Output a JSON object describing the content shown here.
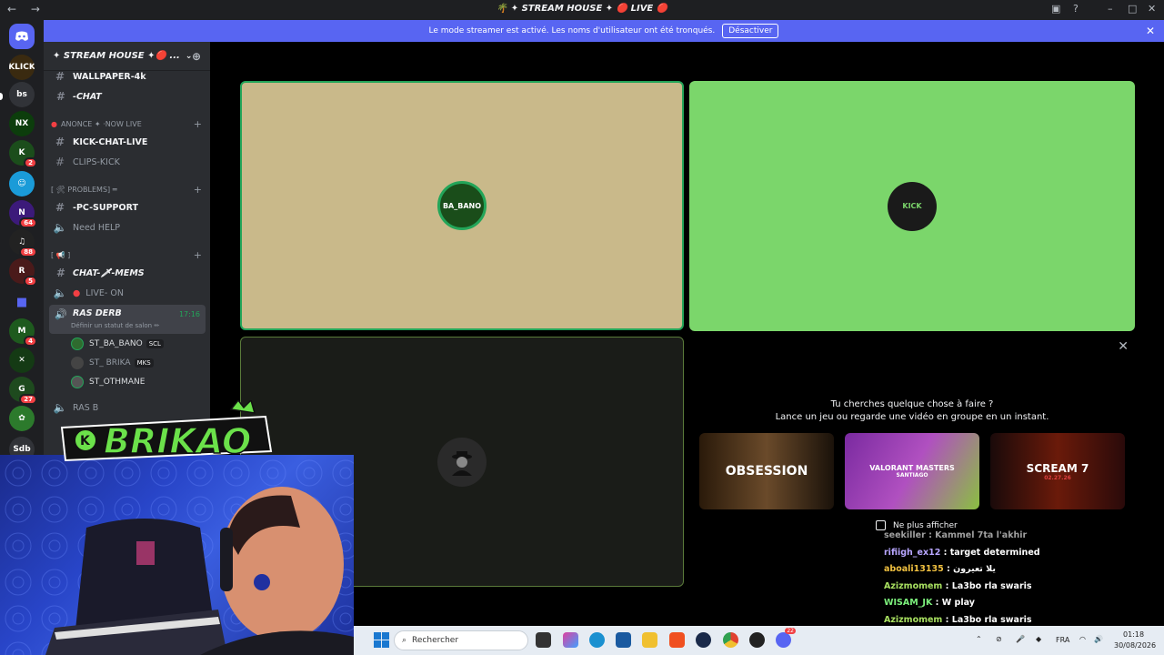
{
  "window": {
    "title": "🌴 ✦ STREAM HOUSE ✦ 🔴 LIVE 🔴",
    "nav_back": "←",
    "nav_forward": "→"
  },
  "streamer_bar": {
    "text": "Le mode streamer est activé. Les noms d'utilisateur ont été tronqués.",
    "button": "Désactiver"
  },
  "guild_labels": {
    "bs": "bs",
    "sdb": "Sdb"
  },
  "guild_badges": [
    "2",
    "64",
    "88",
    "5",
    "4",
    "27"
  ],
  "server": {
    "name": "✦ STREAM HOUSE ✦🔴 ..."
  },
  "channels": {
    "wallpaper": "WALLPAPER-4k",
    "chat": "-CHAT",
    "cat_annonce": "ANONCE ✦ ·NOW LIVE",
    "kick_chat": "KICK-CHAT-LIVE",
    "clips_kick": "CLIPS-KICK",
    "cat_problems": "[ 🛠 PROBLEMS] ═",
    "pc_support": "-PC-SUPPORT",
    "need_help": "Need HELP",
    "cat_misc": "[ 📢 ]",
    "chat_mems": "CHAT-🗡-MEMS",
    "live_on": "LIVE- ON",
    "ras_derb": "RAS DERB",
    "ras_derb_time": "17:16",
    "ras_derb_status": "Définir un statut de salon ✏",
    "rasb": "RAS B"
  },
  "voice_users": [
    {
      "name": "ST_BA_BANO",
      "tag": "SCL"
    },
    {
      "name": "ST_ BRIKA",
      "tag": "MKS"
    },
    {
      "name": "ST_OTHMANE",
      "tag": ""
    }
  ],
  "tiles": {
    "babano_avatar": "BA_BANO",
    "brika_avatar": "KICK"
  },
  "overlay": {
    "brand": "BRIKAO",
    "k": "K"
  },
  "activity": {
    "line1": "Tu cherches quelque chose à faire ?",
    "line2": "Lance un jeu ou regarde une vidéo en groupe en un instant.",
    "cards": [
      {
        "label": "OBSESSION"
      },
      {
        "label": "VALORANT MASTERS",
        "sub": "SANTIAGO"
      },
      {
        "label": "SCREAM 7",
        "sub": "02.27.26"
      }
    ],
    "dont_show": "Ne plus afficher"
  },
  "stream_chat": [
    {
      "user": "seekiller",
      "msg": ": Kammel 7ta l'akhir",
      "color": "#a0a0a0"
    },
    {
      "user": "rifiigh_ex12",
      "msg": ": target determined",
      "color": "#b8a6ff"
    },
    {
      "user": "aboali13135",
      "msg": ": يلا تعيرون",
      "color": "#f0c040"
    },
    {
      "user": "Azizmomem",
      "msg": ": La3bo rla swaris",
      "color": "#a8e060"
    },
    {
      "user": "WISAM_JK",
      "msg": ": W play",
      "color": "#7cf07c"
    },
    {
      "user": "Azizmomem",
      "msg": ": La3bo rla swaris",
      "color": "#a8e060"
    }
  ],
  "taskbar": {
    "search_placeholder": "Rechercher",
    "lang": "FRA",
    "time": "01:18",
    "date": "30/08/2026",
    "discord_badge": "22"
  },
  "colors": {
    "blurple": "#5865f2",
    "green_tile": "#7bd66b",
    "tan_tile": "#c9b98a",
    "speaking_green": "#23a559"
  }
}
